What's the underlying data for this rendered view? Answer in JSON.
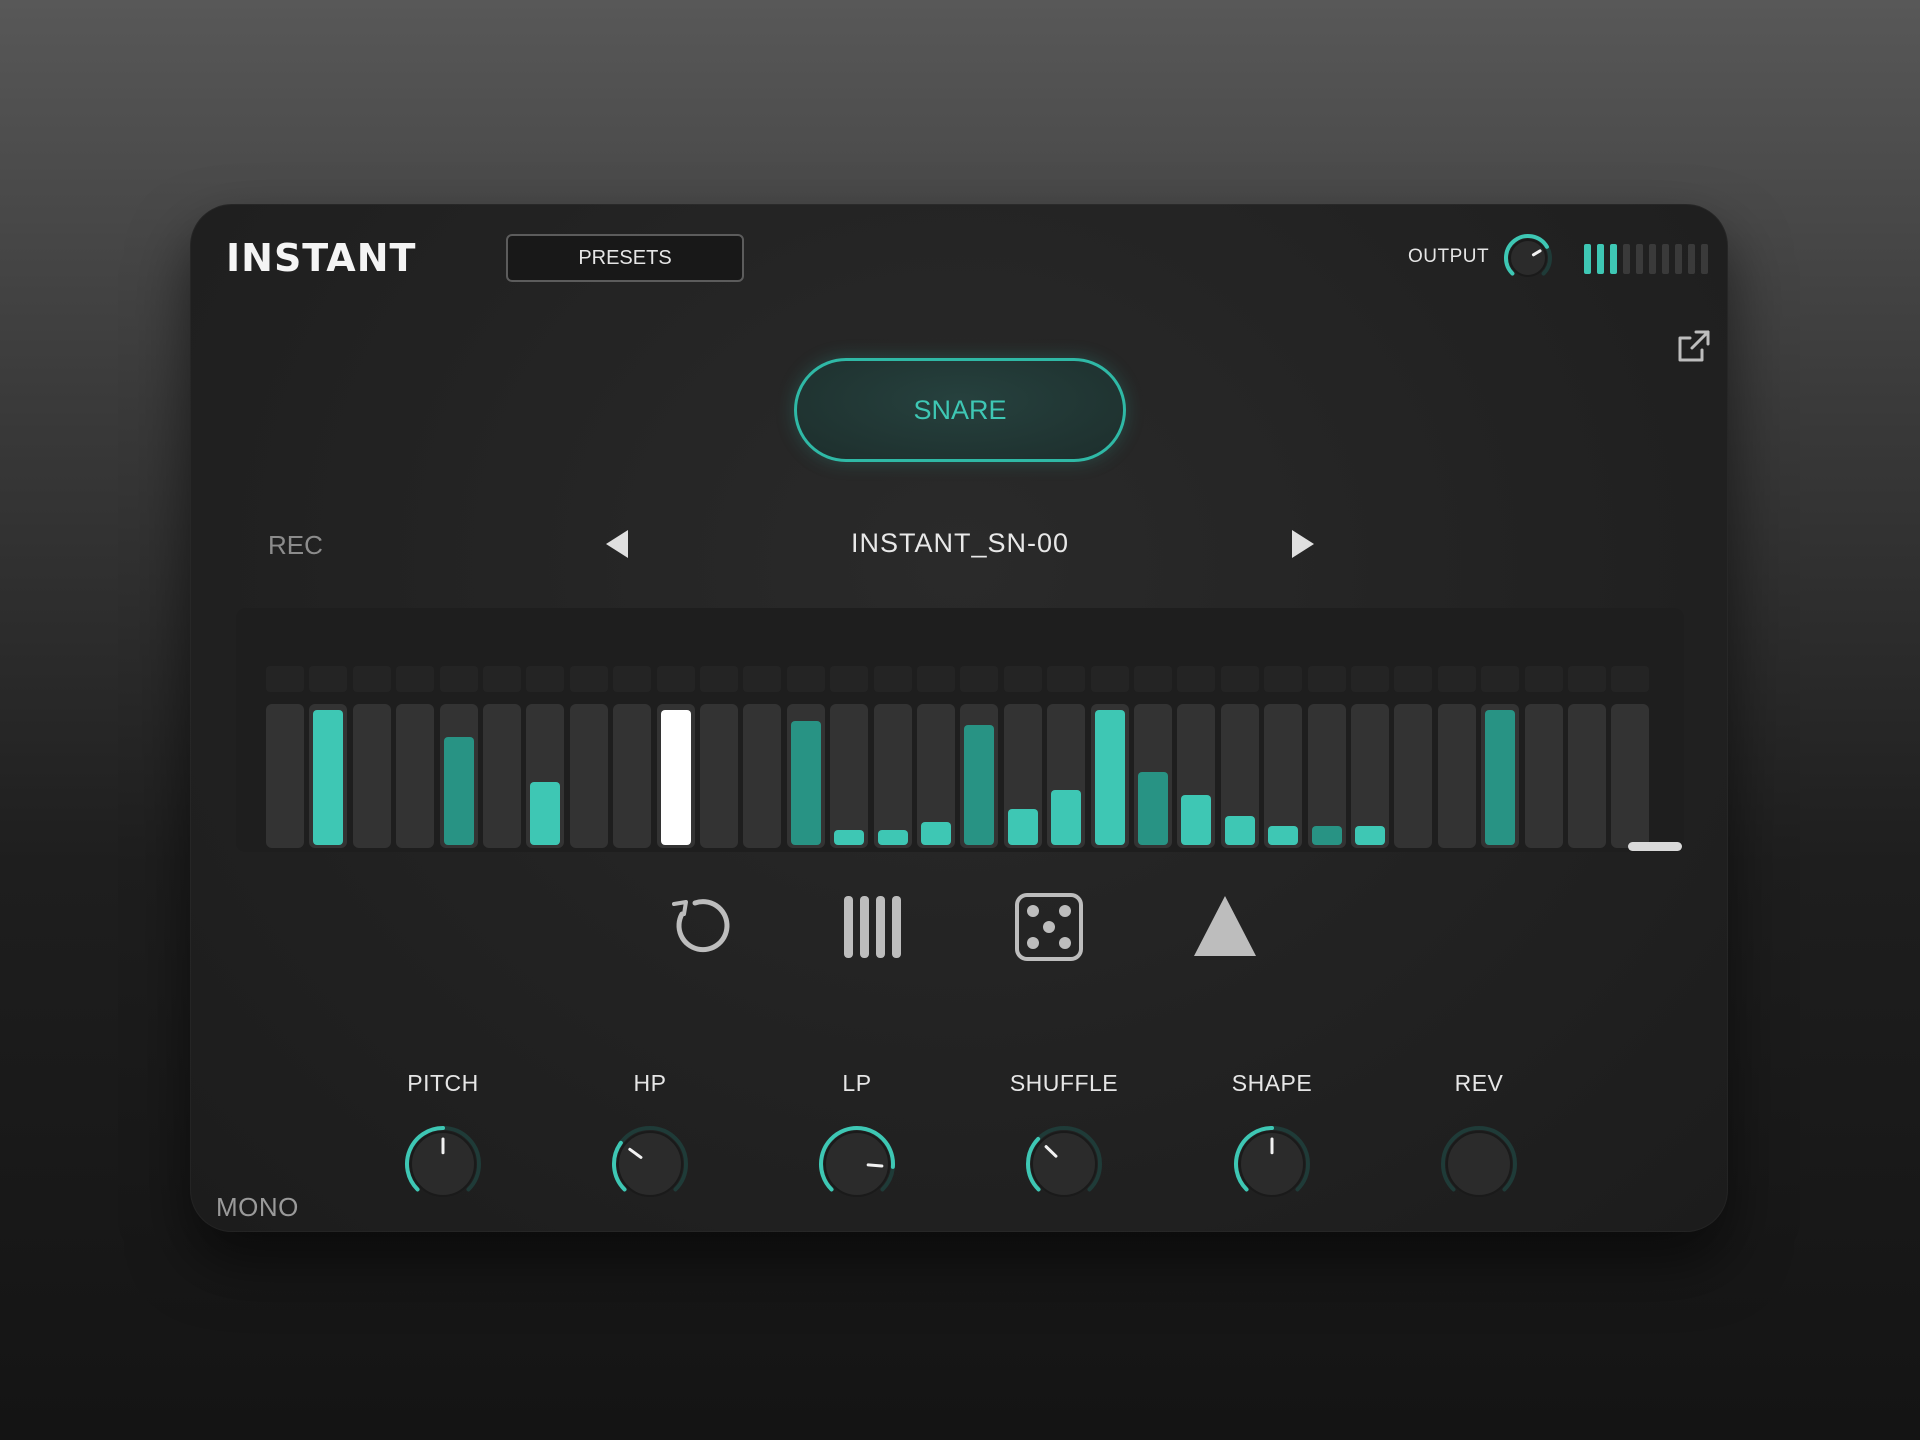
{
  "header": {
    "brand": "INSTANT",
    "presets_label": "PRESETS",
    "output_label": "OUTPUT",
    "output_level": 0.72,
    "meter": {
      "segments": 10,
      "lit": 3
    }
  },
  "instrument": {
    "label": "SNARE"
  },
  "sample": {
    "rec_label": "REC",
    "name": "INSTANT_SN-00"
  },
  "sequencer": {
    "steps": 32,
    "levels": [
      0,
      0.98,
      0,
      0,
      0.78,
      0,
      0.46,
      0,
      0,
      0.98,
      0,
      0,
      0.9,
      0.11,
      0.11,
      0.17,
      0.87,
      0.26,
      0.4,
      0.98,
      0.53,
      0.36,
      0.21,
      0.14,
      0.14,
      0.14,
      0,
      0,
      0.98,
      0,
      0,
      0
    ],
    "styles": [
      "none",
      "bright",
      "none",
      "none",
      "dark",
      "none",
      "bright",
      "none",
      "none",
      "white",
      "none",
      "none",
      "dark",
      "bright",
      "bright",
      "bright",
      "dark",
      "bright",
      "bright",
      "bright",
      "dark",
      "bright",
      "bright",
      "bright",
      "dark",
      "bright",
      "none",
      "none",
      "dark",
      "none",
      "none",
      "none"
    ]
  },
  "tools": [
    {
      "name": "reset-icon"
    },
    {
      "name": "steps-icon"
    },
    {
      "name": "dice-icon"
    },
    {
      "name": "triangle-icon"
    }
  ],
  "knobs": [
    {
      "label": "PITCH",
      "value": 0.5
    },
    {
      "label": "HP",
      "value": 0.3
    },
    {
      "label": "LP",
      "value": 0.85
    },
    {
      "label": "SHUFFLE",
      "value": 0.33
    },
    {
      "label": "SHAPE",
      "value": 0.5
    },
    {
      "label": "REV",
      "value": 0
    }
  ],
  "footer": {
    "mono_label": "MONO"
  },
  "colors": {
    "accent": "#3ec7b4",
    "accent_dark": "#289384",
    "panel": "#222222"
  }
}
